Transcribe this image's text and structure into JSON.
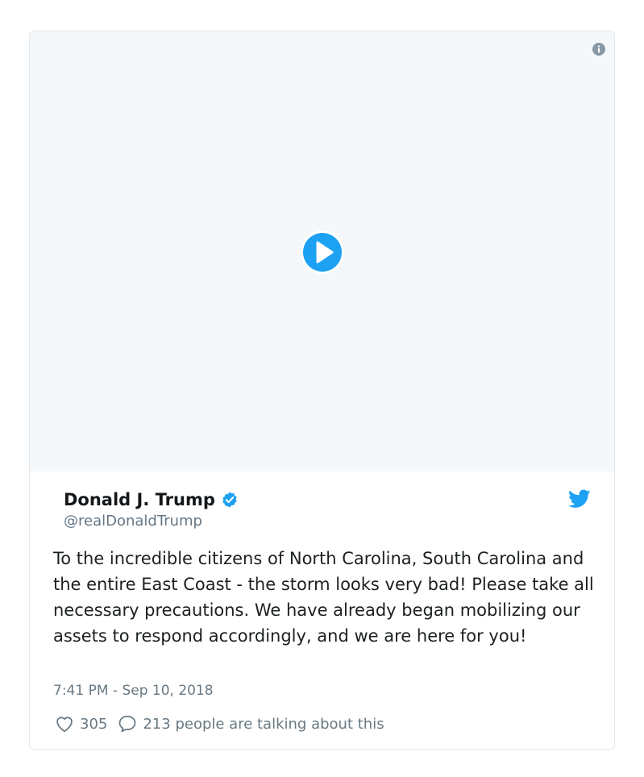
{
  "author": {
    "name": "Donald J. Trump",
    "handle": "@realDonaldTrump",
    "verified": true
  },
  "tweet": {
    "text": "To the incredible citizens of North Carolina, South Carolina and the entire East Coast - the storm looks very bad! Please take all necessary precautions. We have already began mobilizing our assets to respond accordingly, and we are here for you!",
    "timestamp": "7:41 PM - Sep 10, 2018"
  },
  "stats": {
    "likes": "305",
    "conversation": "213 people are talking about this"
  },
  "icons": {
    "info": "info-icon",
    "play": "play-icon",
    "verified": "verified-badge-icon",
    "brand": "twitter-bird-icon",
    "like": "heart-icon",
    "reply": "speech-bubble-icon"
  },
  "colors": {
    "brand": "#1da1f2",
    "media_background": "#f5f8fa",
    "text": "#1c2022",
    "muted": "#697882",
    "border": "#e1e8ed",
    "info_icon": "#8899a6"
  }
}
